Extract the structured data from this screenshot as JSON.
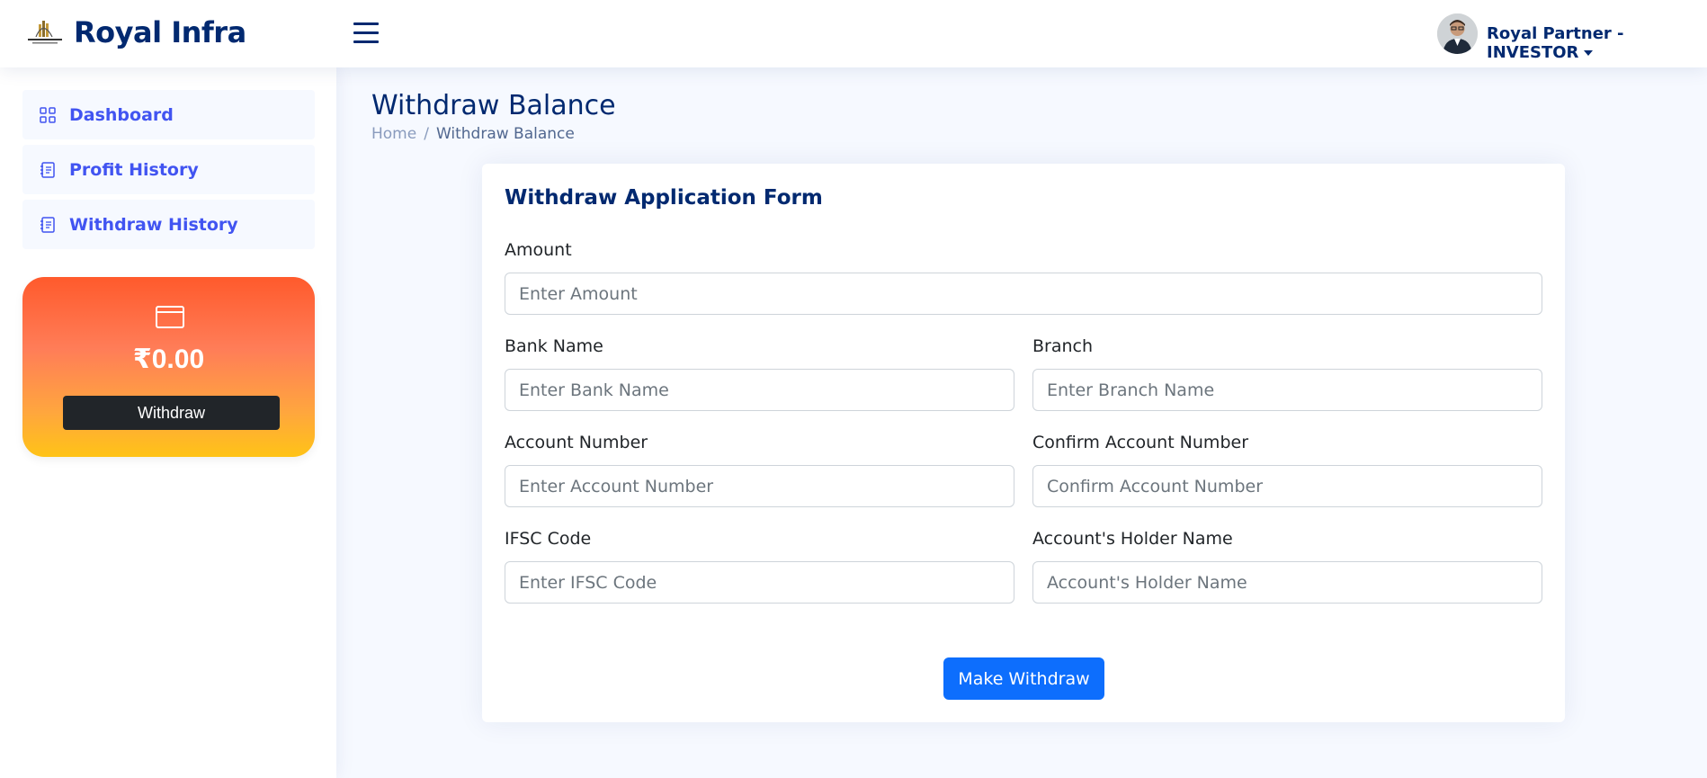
{
  "header": {
    "brand": "Royal Infra",
    "logo_icon": "royal-infra-logo",
    "menu_icon": "hamburger-icon",
    "profile_name": "Royal Partner - INVESTOR"
  },
  "sidebar": {
    "items": [
      {
        "label": "Dashboard",
        "icon": "grid-icon"
      },
      {
        "label": "Profit History",
        "icon": "journal-icon"
      },
      {
        "label": "Withdraw History",
        "icon": "journal-icon"
      }
    ],
    "balance_card": {
      "icon": "wallet-icon",
      "balance": "₹0.00",
      "button_label": "Withdraw"
    }
  },
  "main": {
    "page_title": "Withdraw Balance",
    "breadcrumb": {
      "home": "Home",
      "separator": "/",
      "current": "Withdraw Balance"
    },
    "form": {
      "title": "Withdraw Application Form",
      "amount": {
        "label": "Amount",
        "placeholder": "Enter Amount",
        "value": ""
      },
      "bank_name": {
        "label": "Bank Name",
        "placeholder": "Enter Bank Name",
        "value": ""
      },
      "branch": {
        "label": "Branch",
        "placeholder": "Enter Branch Name",
        "value": ""
      },
      "account_number": {
        "label": "Account Number",
        "placeholder": "Enter Account Number",
        "value": ""
      },
      "confirm_account_number": {
        "label": "Confirm Account Number",
        "placeholder": "Confirm Account Number",
        "value": ""
      },
      "ifsc": {
        "label": "IFSC Code",
        "placeholder": "Enter IFSC Code",
        "value": ""
      },
      "holder_name": {
        "label": "Account's Holder Name",
        "placeholder": "Account's Holder Name",
        "value": ""
      },
      "submit_label": "Make Withdraw"
    }
  },
  "colors": {
    "primary": "#012970",
    "accent": "#4154f1",
    "button_blue": "#0d6efd",
    "card_gradient_top": "#ff5a2c",
    "card_gradient_bottom": "#ffc317"
  }
}
